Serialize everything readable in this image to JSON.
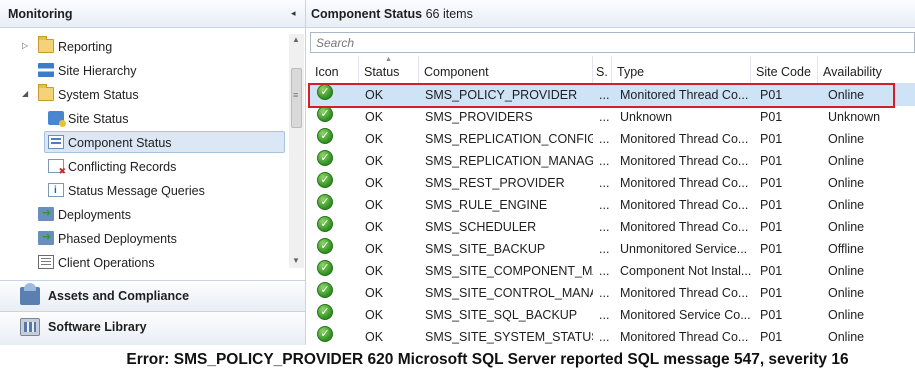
{
  "nav": {
    "title": "Monitoring",
    "collapse_glyph": "◂",
    "tree": [
      {
        "label": "Reporting",
        "icon": "folder-icon"
      },
      {
        "label": "Site Hierarchy",
        "icon": "site-hierarchy-icon"
      },
      {
        "label": "System Status",
        "icon": "folder-icon"
      },
      {
        "label": "Site Status",
        "icon": "site-status-icon"
      },
      {
        "label": "Component Status",
        "icon": "component-status-icon"
      },
      {
        "label": "Conflicting Records",
        "icon": "conflicting-records-icon"
      },
      {
        "label": "Status Message Queries",
        "icon": "status-message-queries-icon"
      },
      {
        "label": "Deployments",
        "icon": "deployments-icon"
      },
      {
        "label": "Phased Deployments",
        "icon": "phased-deployments-icon"
      },
      {
        "label": "Client Operations",
        "icon": "client-operations-icon"
      }
    ],
    "workspaces": [
      {
        "label": "Assets and Compliance",
        "icon": "assets-compliance-icon"
      },
      {
        "label": "Software Library",
        "icon": "software-library-icon"
      }
    ]
  },
  "content": {
    "title": "Component Status",
    "count": "66 items",
    "search_placeholder": "Search",
    "columns": [
      "Icon",
      "Status",
      "Component",
      "S.",
      "Type",
      "Site Code",
      "Availability"
    ],
    "rows": [
      {
        "status": "OK",
        "component": "SMS_POLICY_PROVIDER",
        "s": "...",
        "type": "Monitored Thread Co...",
        "site": "P01",
        "availability": "Online"
      },
      {
        "status": "OK",
        "component": "SMS_PROVIDERS",
        "s": "...",
        "type": "Unknown",
        "site": "P01",
        "availability": "Unknown"
      },
      {
        "status": "OK",
        "component": "SMS_REPLICATION_CONFIG...",
        "s": "...",
        "type": "Monitored Thread Co...",
        "site": "P01",
        "availability": "Online"
      },
      {
        "status": "OK",
        "component": "SMS_REPLICATION_MANAGER",
        "s": "...",
        "type": "Monitored Thread Co...",
        "site": "P01",
        "availability": "Online"
      },
      {
        "status": "OK",
        "component": "SMS_REST_PROVIDER",
        "s": "...",
        "type": "Monitored Thread Co...",
        "site": "P01",
        "availability": "Online"
      },
      {
        "status": "OK",
        "component": "SMS_RULE_ENGINE",
        "s": "...",
        "type": "Monitored Thread Co...",
        "site": "P01",
        "availability": "Online"
      },
      {
        "status": "OK",
        "component": "SMS_SCHEDULER",
        "s": "...",
        "type": "Monitored Thread Co...",
        "site": "P01",
        "availability": "Online"
      },
      {
        "status": "OK",
        "component": "SMS_SITE_BACKUP",
        "s": "...",
        "type": "Unmonitored Service...",
        "site": "P01",
        "availability": "Offline"
      },
      {
        "status": "OK",
        "component": "SMS_SITE_COMPONENT_MA...",
        "s": "...",
        "type": "Component Not Instal...",
        "site": "P01",
        "availability": "Online"
      },
      {
        "status": "OK",
        "component": "SMS_SITE_CONTROL_MANA...",
        "s": "...",
        "type": "Monitored Thread Co...",
        "site": "P01",
        "availability": "Online"
      },
      {
        "status": "OK",
        "component": "SMS_SITE_SQL_BACKUP",
        "s": "...",
        "type": "Monitored Service Co...",
        "site": "P01",
        "availability": "Online"
      },
      {
        "status": "OK",
        "component": "SMS_SITE_SYSTEM_STATUS_...",
        "s": "...",
        "type": "Monitored Thread Co...",
        "site": "P01",
        "availability": "Online"
      }
    ]
  },
  "caption": "Error: SMS_POLICY_PROVIDER 620 Microsoft SQL Server reported SQL message 547, severity 16",
  "colors": {
    "highlight_border": "#d21f2b",
    "selected_row": "#cfe3f7",
    "ok_green": "#2f8f1f"
  }
}
